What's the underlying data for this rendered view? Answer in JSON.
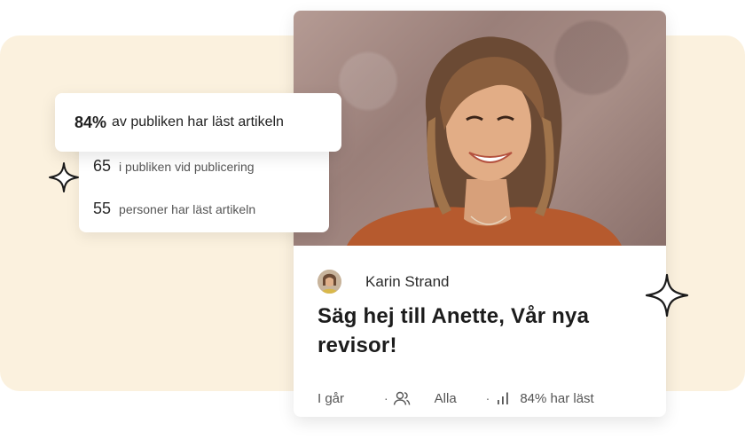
{
  "stats": {
    "headline_value": "84%",
    "headline_label": "av publiken har läst artikeln",
    "rows": [
      {
        "value": "65",
        "label": "i publiken vid publicering"
      },
      {
        "value": "55",
        "label": "personer har läst artikeln"
      }
    ]
  },
  "article": {
    "author": "Karin Strand",
    "title": "Säg hej till Anette, Vår nya revisor!",
    "date": "I går",
    "audience": "Alla",
    "read_stat": "84% har läst"
  },
  "icons": {
    "sparkle": "sparkle-icon",
    "audience": "people-icon",
    "stats": "bar-chart-icon"
  },
  "colors": {
    "background_panel": "#fbf1de",
    "card": "#ffffff",
    "text": "#1f1f1f"
  }
}
